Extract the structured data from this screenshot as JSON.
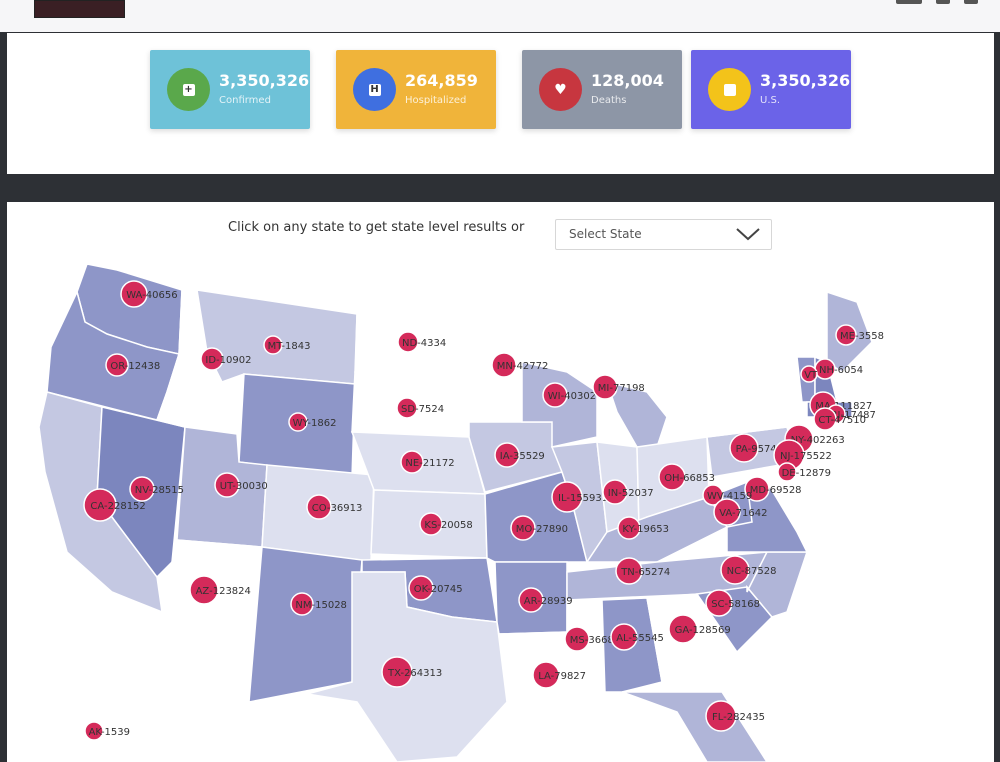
{
  "stats": [
    {
      "value": "3,350,326",
      "label": "Confirmed",
      "color": "#6ec2d8",
      "icon_bg": "#5aa84b",
      "icon": "plus-icon"
    },
    {
      "value": "264,859",
      "label": "Hospitalized",
      "color": "#f0b43a",
      "icon_bg": "#3f6fe0",
      "icon": "hospital-icon"
    },
    {
      "value": "128,004",
      "label": "Deaths",
      "color": "#8d96a6",
      "icon_bg": "#c7363f",
      "icon": "heart-icon"
    },
    {
      "value": "3,350,326",
      "label": "U.S.",
      "color": "#6b63e8",
      "icon_bg": "#f3c31a",
      "icon": "flag-icon"
    }
  ],
  "map": {
    "prompt": "Click on any state to get state level results or",
    "select_placeholder": "Select State"
  },
  "states": [
    {
      "label": "WA-40656"
    },
    {
      "label": "OR-12438"
    },
    {
      "label": "ID-10902"
    },
    {
      "label": "MT-1843"
    },
    {
      "label": "ND-4334"
    },
    {
      "label": "MN-42772"
    },
    {
      "label": "ME-3558"
    },
    {
      "label": "WI-40302"
    },
    {
      "label": "MI-77198"
    },
    {
      "label": "SD-7524"
    },
    {
      "label": "WY-1862"
    },
    {
      "label": "NH-6054"
    },
    {
      "label": "VT"
    },
    {
      "label": "MA-111827"
    },
    {
      "label": "RI-17487"
    },
    {
      "label": "CT-47510"
    },
    {
      "label": "NY-402263"
    },
    {
      "label": "PA-95742"
    },
    {
      "label": "NJ-175522"
    },
    {
      "label": "IA-35529"
    },
    {
      "label": "NE-21172"
    },
    {
      "label": "NV-28515"
    },
    {
      "label": "UT-30030"
    },
    {
      "label": "CA-228152"
    },
    {
      "label": "CO-36913"
    },
    {
      "label": "IL-155931"
    },
    {
      "label": "IN-52037"
    },
    {
      "label": "OH-66853"
    },
    {
      "label": "DE-12879"
    },
    {
      "label": "MD-69528"
    },
    {
      "label": "WV-4159"
    },
    {
      "label": "VA-71642"
    },
    {
      "label": "KS-20058"
    },
    {
      "label": "MO-27890"
    },
    {
      "label": "KY-19653"
    },
    {
      "label": "TN-65274"
    },
    {
      "label": "NC-87528"
    },
    {
      "label": "AZ-123824"
    },
    {
      "label": "NM-15028"
    },
    {
      "label": "OK-20745"
    },
    {
      "label": "AR-28939"
    },
    {
      "label": "SC-58168"
    },
    {
      "label": "MS-36680"
    },
    {
      "label": "AL-55545"
    },
    {
      "label": "GA-128569"
    },
    {
      "label": "TX-264313"
    },
    {
      "label": "LA-79827"
    },
    {
      "label": "FL-282435"
    },
    {
      "label": "AK-1539"
    }
  ]
}
